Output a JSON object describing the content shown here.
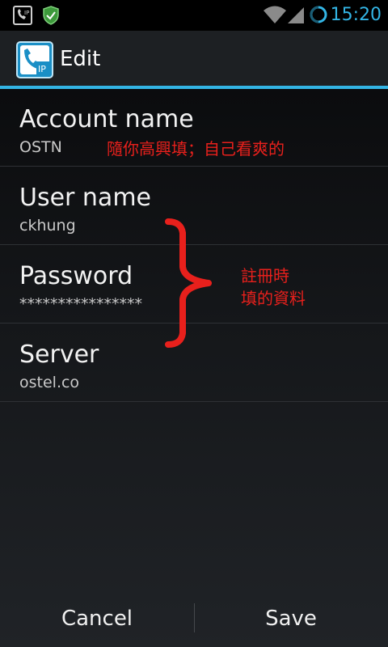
{
  "status_bar": {
    "time": "15:20",
    "icons": [
      "voip-notification-icon",
      "shield-check-icon",
      "wifi-icon",
      "signal-icon",
      "battery-charging-icon"
    ]
  },
  "action_bar": {
    "icon": "ip-phone-app-icon",
    "title": "Edit"
  },
  "preferences": [
    {
      "title": "Account name",
      "summary": "OSTN"
    },
    {
      "title": "User name",
      "summary": "ckhung"
    },
    {
      "title": "Password",
      "summary": "****************"
    },
    {
      "title": "Server",
      "summary": "ostel.co"
    }
  ],
  "annotations": {
    "account_note": "隨你高興填；自己看爽的",
    "register_note_line1": "註冊時",
    "register_note_line2": "填的資料",
    "color": "#e8201c"
  },
  "buttons": {
    "cancel": "Cancel",
    "save": "Save"
  },
  "colors": {
    "accent": "#33b5e5",
    "background": "#111315",
    "annotation": "#e8201c"
  }
}
